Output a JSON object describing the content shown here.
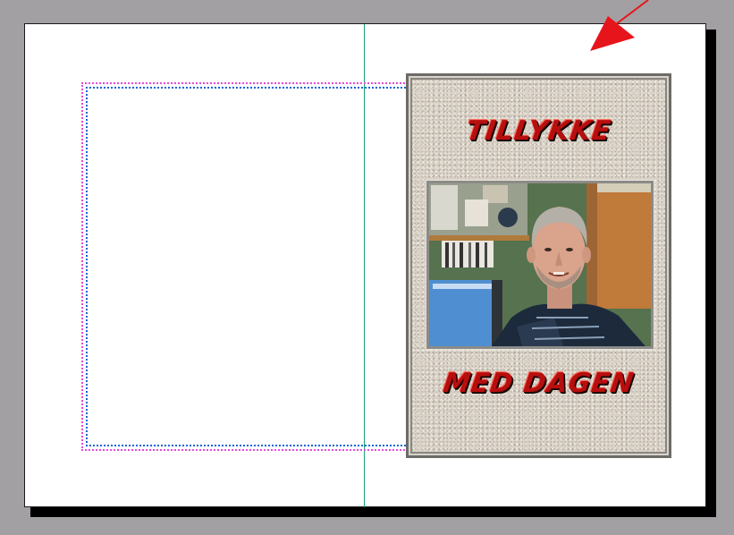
{
  "card": {
    "title_top": "TILLYKKE",
    "title_bottom": "MED DAGEN",
    "photo": "portrait-photo"
  },
  "colors": {
    "pasteboard": "#a2a0a2",
    "page": "#ffffff",
    "guide": "#19a07a",
    "margin_magenta": "#e54ad6",
    "margin_blue": "#1764d8",
    "card_text": "#b70f0f",
    "arrow": "#e8141c"
  },
  "icons": {
    "pointer": "red-arrow-icon"
  }
}
